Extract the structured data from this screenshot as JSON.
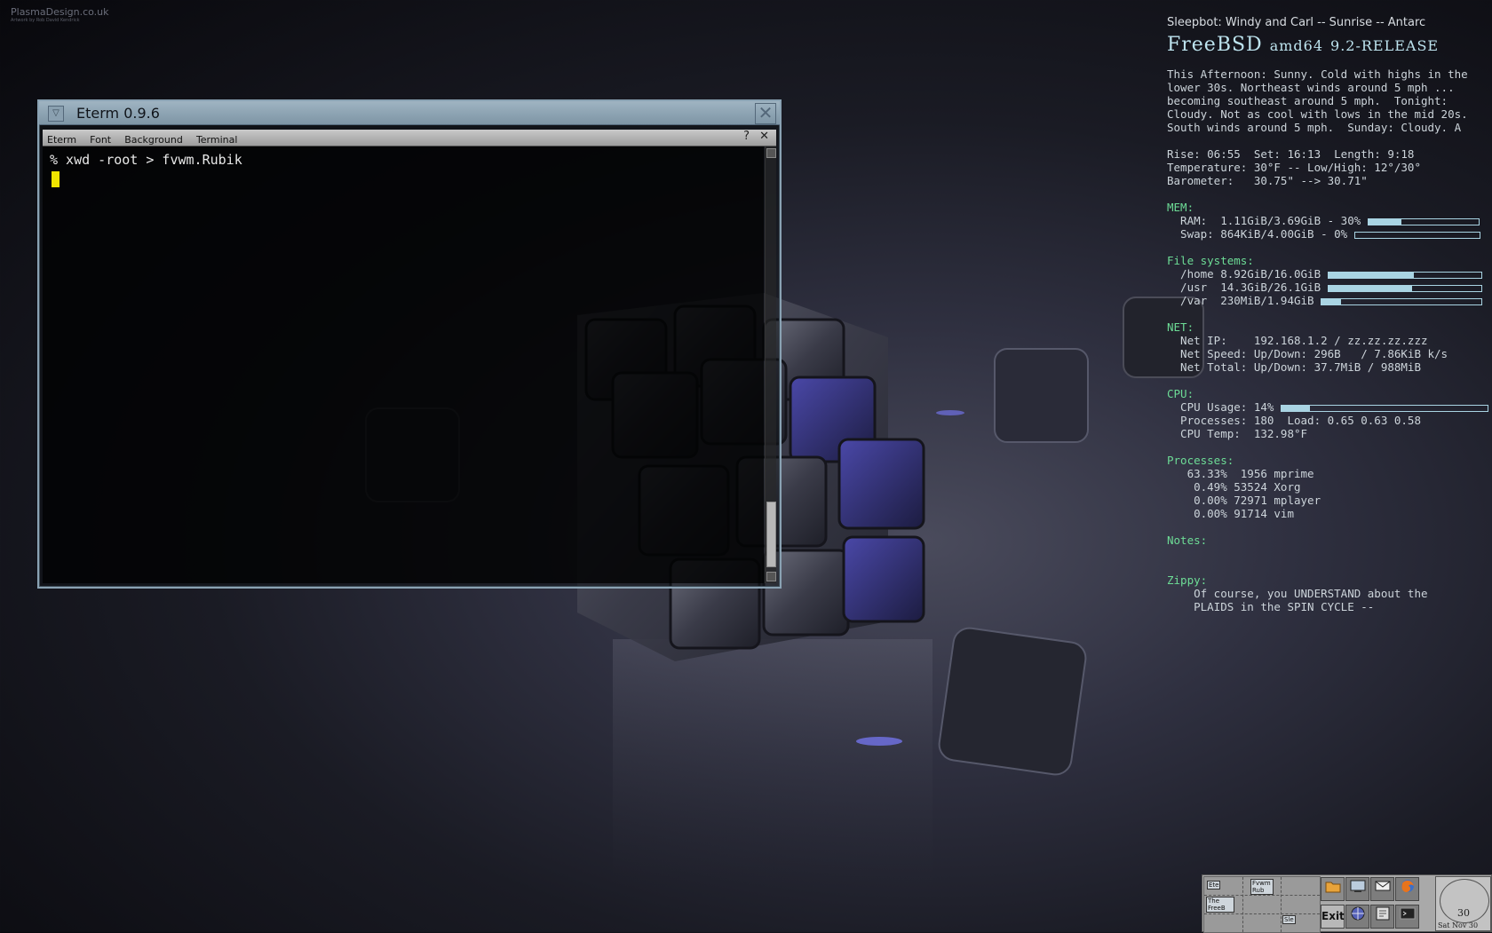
{
  "wallpaper": {
    "credit": "PlasmaDesign.co.uk",
    "credit_sub": "Artwork by Rob David Kendrick"
  },
  "eterm": {
    "title": "Eterm 0.9.6",
    "menus": [
      "Eterm",
      "Font",
      "Background",
      "Terminal"
    ],
    "help": "?",
    "close": "✕",
    "command": "% xwd -root > fvwm.Rubik"
  },
  "conky": {
    "now_playing": "Sleepbot: Windy and Carl -- Sunrise -- Antarc",
    "os_name": "FreeBSD",
    "os_arch": "amd64",
    "os_release": "9.2-RELEASE",
    "weather": [
      "This Afternoon: Sunny. Cold with highs in the",
      "lower 30s. Northeast winds around 5 mph ...",
      "becoming southeast around 5 mph.  Tonight:",
      "Cloudy. Not as cool with lows in the mid 20s.",
      "South winds around 5 mph.  Sunday: Cloudy. A"
    ],
    "sun": "Rise: 06:55  Set: 16:13  Length: 9:18",
    "temperature": "Temperature: 30°F -- Low/High: 12°/30°",
    "barometer": "Barometer:   30.75\" --> 30.71\"",
    "mem_header": "MEM:",
    "ram": "  RAM:  1.11GiB/3.69GiB - 30%",
    "ram_pct": 30,
    "swap": "  Swap: 864KiB/4.00GiB - 0%",
    "swap_pct": 0,
    "fs_header": "File systems:",
    "fs_home": "  /home 8.92GiB/16.0GiB",
    "fs_home_pct": 56,
    "fs_usr": "  /usr  14.3GiB/26.1GiB",
    "fs_usr_pct": 55,
    "fs_var": "  /var  230MiB/1.94GiB",
    "fs_var_pct": 12,
    "net_header": "NET:",
    "net_ip": "  Net IP:    192.168.1.2 / zz.zz.zz.zzz",
    "net_speed": "  Net Speed: Up/Down: 296B   / 7.86KiB k/s",
    "net_total": "  Net Total: Up/Down: 37.7MiB / 988MiB",
    "cpu_header": "CPU:",
    "cpu_usage": "  CPU Usage: 14%",
    "cpu_pct": 14,
    "cpu_procs": "  Processes: 180  Load: 0.65 0.63 0.58",
    "cpu_temp": "  CPU Temp:  132.98°F",
    "proc_header": "Processes:",
    "processes": [
      "   63.33%  1956 mprime",
      "    0.49% 53524 Xorg",
      "    0.00% 72971 mplayer",
      "    0.00% 91714 vim"
    ],
    "notes_header": "Notes:",
    "zippy_header": "Zippy:",
    "zippy": [
      "    Of course, you UNDERSTAND about the",
      "    PLAIDS in the SPIN CYCLE --"
    ]
  },
  "panel": {
    "pager_windows": [
      "Ete",
      "Fvwm Rub",
      "The FreeB",
      "Sle"
    ],
    "exit": "Exit",
    "clock_day": "30",
    "clock_date": "Sat Nov 30"
  }
}
